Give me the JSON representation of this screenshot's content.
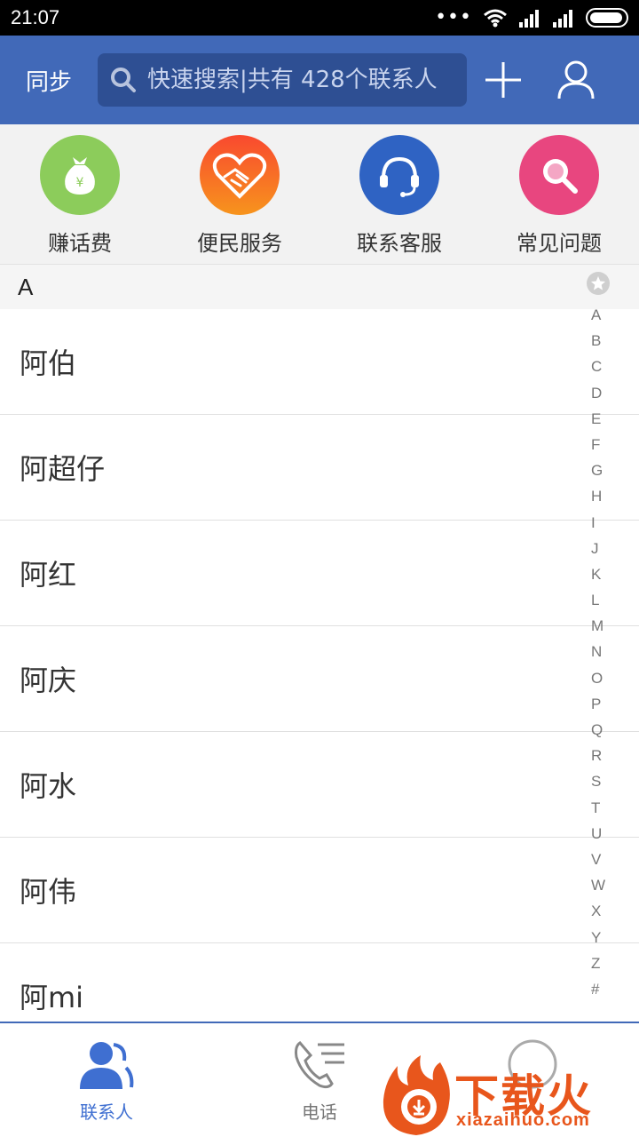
{
  "status_bar": {
    "time": "21:07",
    "dots": "•••"
  },
  "header": {
    "sync_label": "同步",
    "search_placeholder": "快速搜索|共有 428个联系人",
    "icons": [
      "search-icon",
      "add-icon",
      "profile-icon"
    ]
  },
  "quick_actions": [
    {
      "label": "赚话费",
      "icon": "money-bag-icon",
      "color": "#8ccc5b"
    },
    {
      "label": "便民服务",
      "icon": "heart-handshake-icon",
      "color": "#f57a26"
    },
    {
      "label": "联系客服",
      "icon": "headset-icon",
      "color": "#2f63c3"
    },
    {
      "label": "常见问题",
      "icon": "magnifier-icon",
      "color": "#e8467f"
    }
  ],
  "section": {
    "letter": "A"
  },
  "contacts": [
    "阿伯",
    "阿超仔",
    "阿红",
    "阿庆",
    "阿水",
    "阿伟",
    "阿mi"
  ],
  "alpha_index": [
    "A",
    "B",
    "C",
    "D",
    "E",
    "F",
    "G",
    "H",
    "I",
    "J",
    "K",
    "L",
    "M",
    "N",
    "O",
    "P",
    "Q",
    "R",
    "S",
    "T",
    "U",
    "V",
    "W",
    "X",
    "Y",
    "Z",
    "#"
  ],
  "bottom_nav": [
    {
      "label": "联系人",
      "icon": "contacts-icon",
      "active": true
    },
    {
      "label": "电话",
      "icon": "phone-icon",
      "active": false
    },
    {
      "label": "",
      "icon": "more-icon",
      "active": false
    }
  ],
  "watermark": {
    "text_cn": "下载火",
    "text_en": "xiazaihuo.com"
  },
  "colors": {
    "header": "#4169b8",
    "search_bg": "#2e4f93",
    "active": "#3f6fd1"
  }
}
